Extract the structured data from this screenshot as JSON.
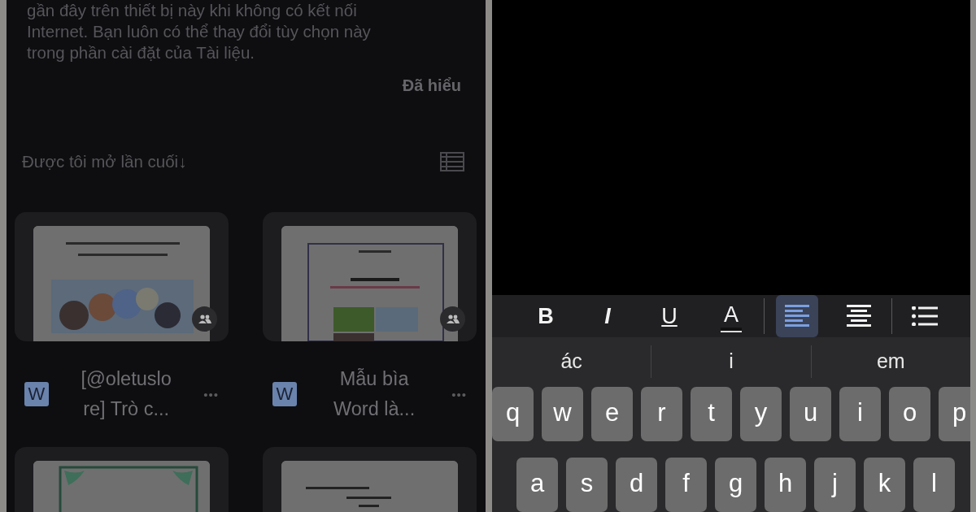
{
  "notice": {
    "lines": [
      "gần đây trên thiết bị này khi không có kết nối",
      "Internet. Bạn luôn có thể thay đổi tùy chọn này",
      "trong phần cài đặt của Tài liệu."
    ],
    "dismiss": "Đã hiểu"
  },
  "sort": {
    "label": "Được tôi mở lần cuối",
    "arrow": "↓"
  },
  "files": [
    {
      "title_lines": [
        "[@oletuslo",
        "re] Trò c..."
      ],
      "badge": "W",
      "shared": true,
      "more": "•••",
      "thumb": {
        "kind": "picture"
      }
    },
    {
      "title_lines": [
        "Mẫu bìa",
        "Word là..."
      ],
      "badge": "W",
      "shared": true,
      "more": "•••",
      "thumb": {
        "kind": "picture"
      }
    },
    {
      "thumb": {
        "kind": "picture"
      }
    },
    {
      "thumb": {
        "kind": "picture"
      }
    }
  ],
  "toolbar": [
    {
      "kind": "bold",
      "label": "B",
      "selected": false
    },
    {
      "kind": "italic",
      "label": "I",
      "selected": false
    },
    {
      "kind": "underline",
      "label": "U",
      "selected": false
    },
    {
      "kind": "color",
      "label": "A",
      "selected": false
    },
    {
      "kind": "divider"
    },
    {
      "kind": "align-left",
      "selected": true
    },
    {
      "kind": "align-center",
      "selected": false
    },
    {
      "kind": "divider"
    },
    {
      "kind": "list",
      "selected": false
    }
  ],
  "suggestions": [
    "ác",
    "i",
    "em"
  ],
  "keys": [
    [
      "q",
      "w",
      "e",
      "r",
      "t",
      "y",
      "u",
      "i",
      "o",
      "p"
    ],
    [
      "a",
      "s",
      "d",
      "f",
      "g",
      "h",
      "j",
      "k",
      "l"
    ]
  ]
}
